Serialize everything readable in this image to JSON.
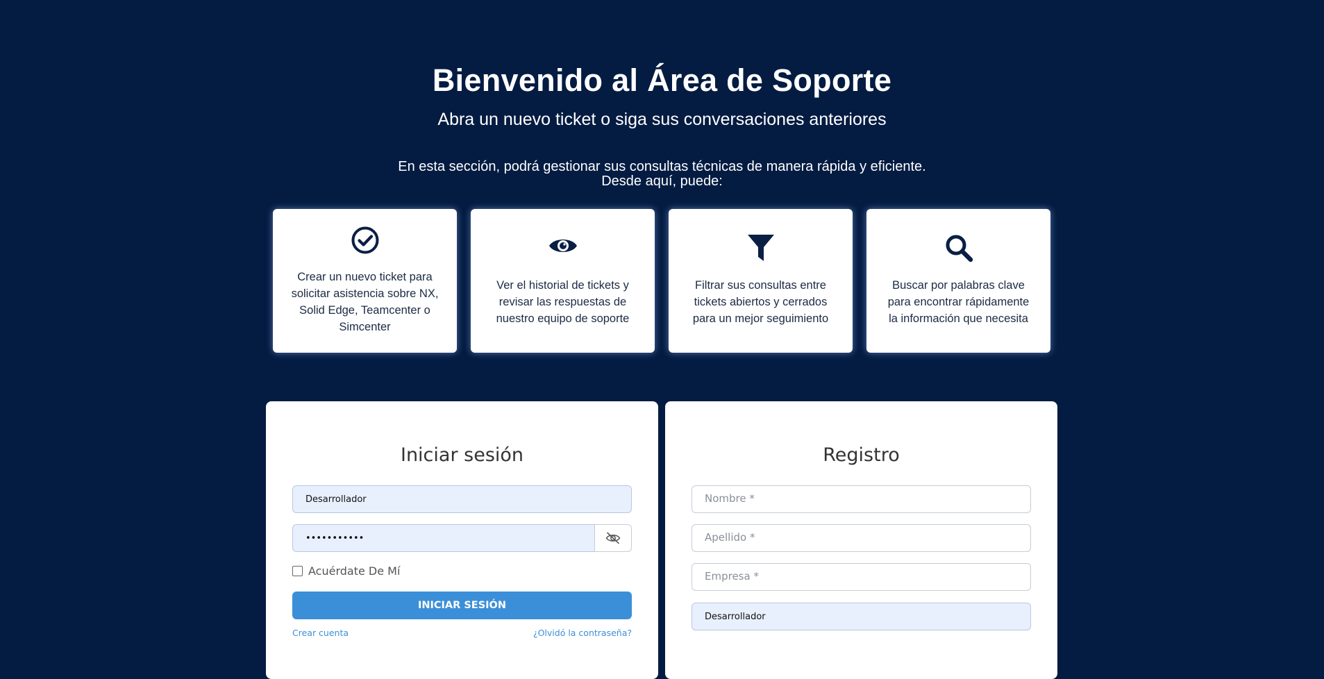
{
  "hero": {
    "title": "Bienvenido al Área de Soporte",
    "subtitle": "Abra un nuevo ticket o siga sus conversaciones anteriores",
    "intro_line1": "En esta sección, podrá gestionar sus consultas técnicas de manera rápida y eficiente.",
    "intro_line2": "Desde aquí, puede:"
  },
  "features": [
    {
      "icon": "check-circle-icon",
      "text": "Crear un nuevo ticket para solicitar asistencia sobre NX, Solid Edge, Teamcenter o Simcenter"
    },
    {
      "icon": "eye-icon",
      "text": "Ver el historial de tickets y revisar las respuestas de nuestro equipo de soporte"
    },
    {
      "icon": "filter-icon",
      "text": "Filtrar sus consultas entre tickets abiertos y cerrados para un mejor seguimiento"
    },
    {
      "icon": "search-icon",
      "text": "Buscar por palabras clave para encontrar rápidamente la información que necesita"
    }
  ],
  "login": {
    "title": "Iniciar sesión",
    "username_value": "Desarrollador",
    "password_value": "•••••••••••",
    "password_toggle_icon": "eye-slash-icon",
    "remember_label": "Acuérdate De Mí",
    "submit_label": "INICIAR SESIÓN",
    "create_account_link": "Crear cuenta",
    "forgot_password_link": "¿Olvidó la contraseña?"
  },
  "register": {
    "title": "Registro",
    "name_placeholder": "Nombre *",
    "lastname_placeholder": "Apellido *",
    "company_placeholder": "Empresa *",
    "username_value": "Desarrollador"
  },
  "colors": {
    "background": "#041c42",
    "accent": "#3b8fd8",
    "icon": "#0a1f44",
    "autofill": "#e8f0fe"
  }
}
